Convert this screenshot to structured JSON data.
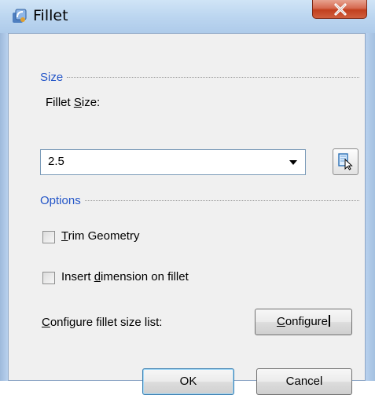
{
  "window": {
    "title": "Fillet",
    "icon": "fillet-app-icon",
    "close_icon": "close-x-icon"
  },
  "size_section": {
    "heading": "Size",
    "fillet_size_label_pre": "Fillet ",
    "fillet_size_label_key": "S",
    "fillet_size_label_post": "ize:",
    "fillet_size_value": "2.5",
    "dropdown_icon": "chevron-down-icon",
    "pick_icon": "select-from-model-icon"
  },
  "options_section": {
    "heading": "Options",
    "trim_geometry": {
      "key": "T",
      "rest": "rim Geometry",
      "checked": false
    },
    "insert_dimension": {
      "pre": "Insert ",
      "key": "d",
      "rest": "imension on fillet",
      "checked": false
    }
  },
  "configure": {
    "label_key": "C",
    "label_rest": "onfigure fillet size list:",
    "button_key": "C",
    "button_rest": "onfigure"
  },
  "footer": {
    "ok_label": "OK",
    "cancel_label": "Cancel"
  },
  "colors": {
    "section_heading": "#2456c8",
    "dialog_background": "#f0f0f0",
    "title_bar": "#bcd6f0",
    "close_button": "#c2401f"
  }
}
